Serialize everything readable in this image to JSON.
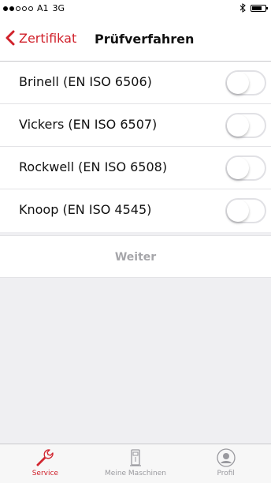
{
  "status": {
    "carrier": "A1",
    "network": "3G",
    "signal_bars_filled": 2,
    "signal_bars_total": 5,
    "battery_level": 0.65
  },
  "nav": {
    "back_label": "Zertifikat",
    "title": "Prüfverfahren"
  },
  "items": [
    {
      "label": "Brinell (EN ISO 6506)",
      "enabled": false
    },
    {
      "label": "Vickers (EN ISO 6507)",
      "enabled": false
    },
    {
      "label": "Rockwell (EN ISO 6508)",
      "enabled": false
    },
    {
      "label": "Knoop (EN ISO 4545)",
      "enabled": false
    }
  ],
  "action": {
    "label": "Weiter"
  },
  "tabs": [
    {
      "label": "Service",
      "icon": "wrench-icon",
      "active": true
    },
    {
      "label": "Meine Maschinen",
      "icon": "machine-icon",
      "active": false
    },
    {
      "label": "Profil",
      "icon": "profile-icon",
      "active": false
    }
  ],
  "colors": {
    "accent": "#d0202a",
    "inactive": "#9a9a9f"
  }
}
